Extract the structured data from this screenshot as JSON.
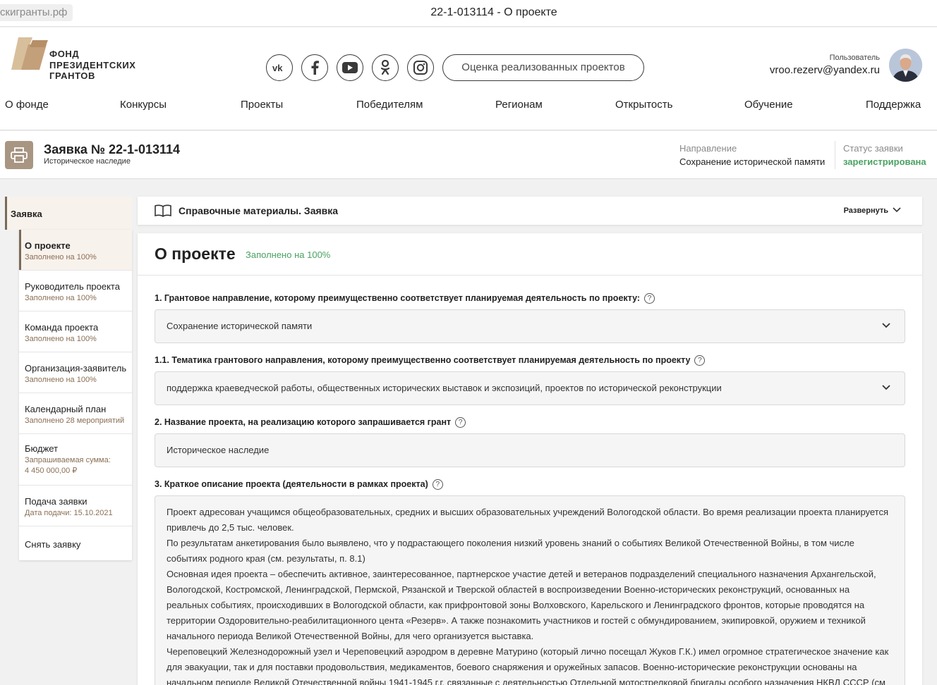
{
  "window": {
    "url": "скигранты.рф",
    "title": "22-1-013114 - О проекте"
  },
  "header": {
    "logo_text": "ФОНД\nПРЕЗИДЕНТСКИХ\nГРАНТОВ",
    "social": [
      "vk-icon",
      "facebook-icon",
      "youtube-icon",
      "odnoklassniki-icon",
      "instagram-icon"
    ],
    "eval_button": "Оценка реализованных проектов",
    "user_role": "Пользователь",
    "user_email": "vroo.rezerv@yandex.ru",
    "nav": [
      "О фонде",
      "Конкурсы",
      "Проекты",
      "Победителям",
      "Регионам",
      "Открытость",
      "Обучение",
      "Поддержка"
    ]
  },
  "application": {
    "title": "Заявка № 22-1-013114",
    "subtitle": "Историческое наследие",
    "direction_label": "Направление",
    "direction_value": "Сохранение исторической памяти",
    "status_label": "Статус заявки",
    "status_value": "зарегистрирована"
  },
  "sidebar": {
    "header": "Заявка",
    "items": [
      {
        "title": "О проекте",
        "sub": "Заполнено на 100%"
      },
      {
        "title": "Руководитель проекта",
        "sub": "Заполнено на 100%"
      },
      {
        "title": "Команда проекта",
        "sub": "Заполнено на 100%"
      },
      {
        "title": "Организация-заявитель",
        "sub": "Заполнено на 100%"
      },
      {
        "title": "Календарный план",
        "sub": "Заполнено 28 мероприятий"
      },
      {
        "title": "Бюджет",
        "sub": "Запрашиваемая сумма:\n4 450 000,00 ₽"
      },
      {
        "title": "Подача заявки",
        "sub": "Дата подачи: 15.10.2021"
      },
      {
        "title": "Снять заявку",
        "sub": ""
      }
    ]
  },
  "reference": {
    "title": "Справочные материалы. Заявка",
    "expand": "Развернуть"
  },
  "form": {
    "title": "О проекте",
    "status": "Заполнено на 100%",
    "q1_label": "1. Грантовое направление, которому преимущественно соответствует планируемая деятельность по проекту:",
    "q1_value": "Сохранение исторической памяти",
    "q11_label": "1.1. Тематика грантового направления, которому преимущественно соответствует планируемая деятельность по проекту",
    "q11_value": "поддержка краеведческой работы, общественных исторических выставок и экспозиций, проектов по исторической реконструкции",
    "q2_label": "2. Название проекта, на реализацию которого запрашивается грант",
    "q2_value": "Историческое наследие",
    "q3_label": "3. Краткое описание проекта (деятельности в рамках проекта)",
    "q3_paragraphs": [
      "Проект адресован учащимся общеобразовательных, средних и высших образовательных учреждений Вологодской области. Во время реализации проекта планируется привлечь до 2,5 тыс. человек.",
      "По результатам анкетирования было выявлено, что у подрастающего поколения низкий уровень знаний о событиях Великой Отечественной Войны, в том числе событиях родного края (см. результаты, п. 8.1)",
      "Основная идея проекта – обеспечить активное, заинтересованное, партнерское участие детей и ветеранов подразделений специального назначения Архангельской, Вологодской, Костромской, Ленинградской, Пермской, Рязанской и Тверской областей в воспроизведении Военно-исторических реконструкций, основанных на реальных событиях, происходивших в Вологодской области, как прифронтовой зоны Волховского, Карельского и Ленинградского фронтов, которые проводятся на территории Оздоровительно-реабилитационного цента «Резерв». А также познакомить участников и гостей с обмундированием, экипировкой, оружием и техникой начального периода Великой Отечественной Войны, для чего организуется выставка.",
      "Череповецкий Железнодорожный узел и Череповецкий аэродром в деревне Матурино (который лично посещал Жуков Г.К.) имел огромное стратегическое значение как для эвакуации, так и для поставки продовольствия, медикаментов, боевого снаряжения и оружейных запасов. Военно-исторические реконструкции основаны на начальном периоде Великой Отечественной войны 1941-1945 г.г. связанные с деятельностью Отдельной мотострелковой бригады особого назначения НКВД СССР (см"
    ],
    "help_symbol": "?"
  },
  "colors": {
    "accent_brown": "#7b6a59",
    "status_green": "#4aa261",
    "logo_tan": "#c4a07a"
  }
}
